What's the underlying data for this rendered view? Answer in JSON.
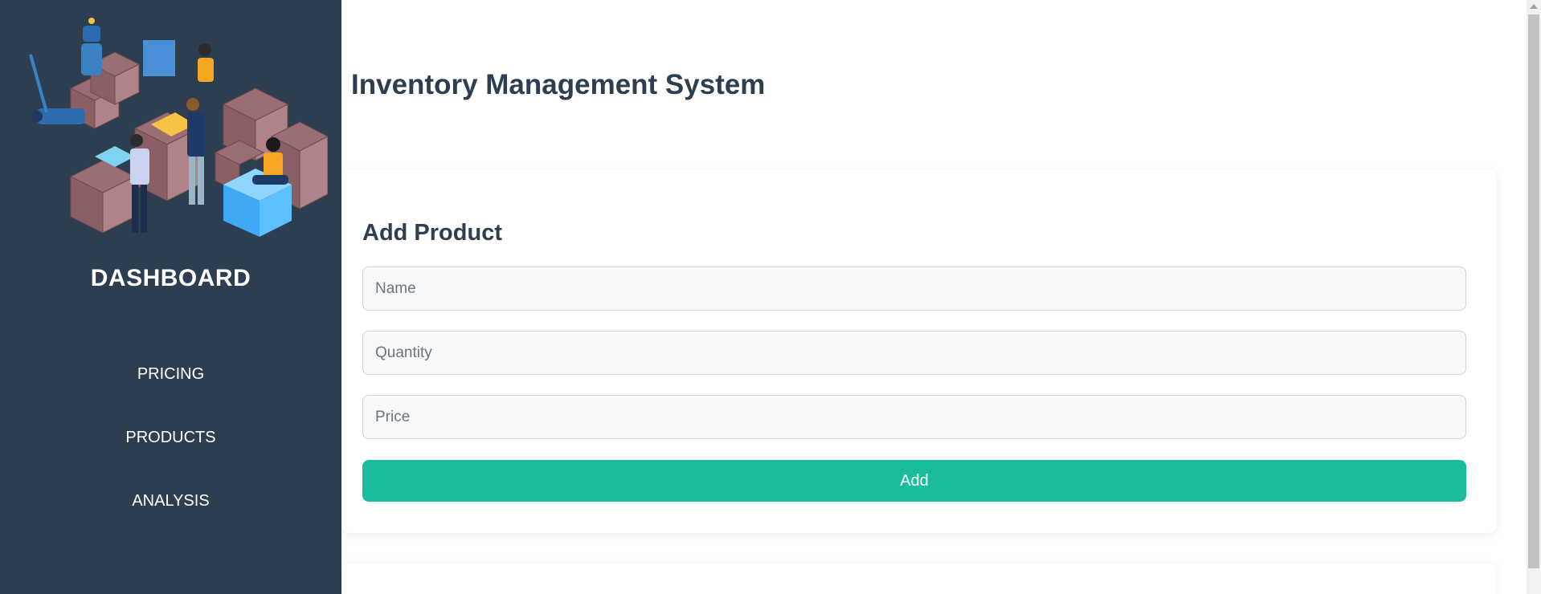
{
  "sidebar": {
    "title": "DASHBOARD",
    "illustration_icon": "warehouse-illustration",
    "items": [
      {
        "label": "PRICING"
      },
      {
        "label": "PRODUCTS"
      },
      {
        "label": "ANALYSIS"
      }
    ],
    "background_color": "#2c3e50"
  },
  "main": {
    "title": "Inventory Management System",
    "form": {
      "title": "Add Product",
      "fields": [
        {
          "placeholder": "Name",
          "value": ""
        },
        {
          "placeholder": "Quantity",
          "value": ""
        },
        {
          "placeholder": "Price",
          "value": ""
        }
      ],
      "submit_label": "Add",
      "accent_color": "#1abc9c"
    }
  }
}
